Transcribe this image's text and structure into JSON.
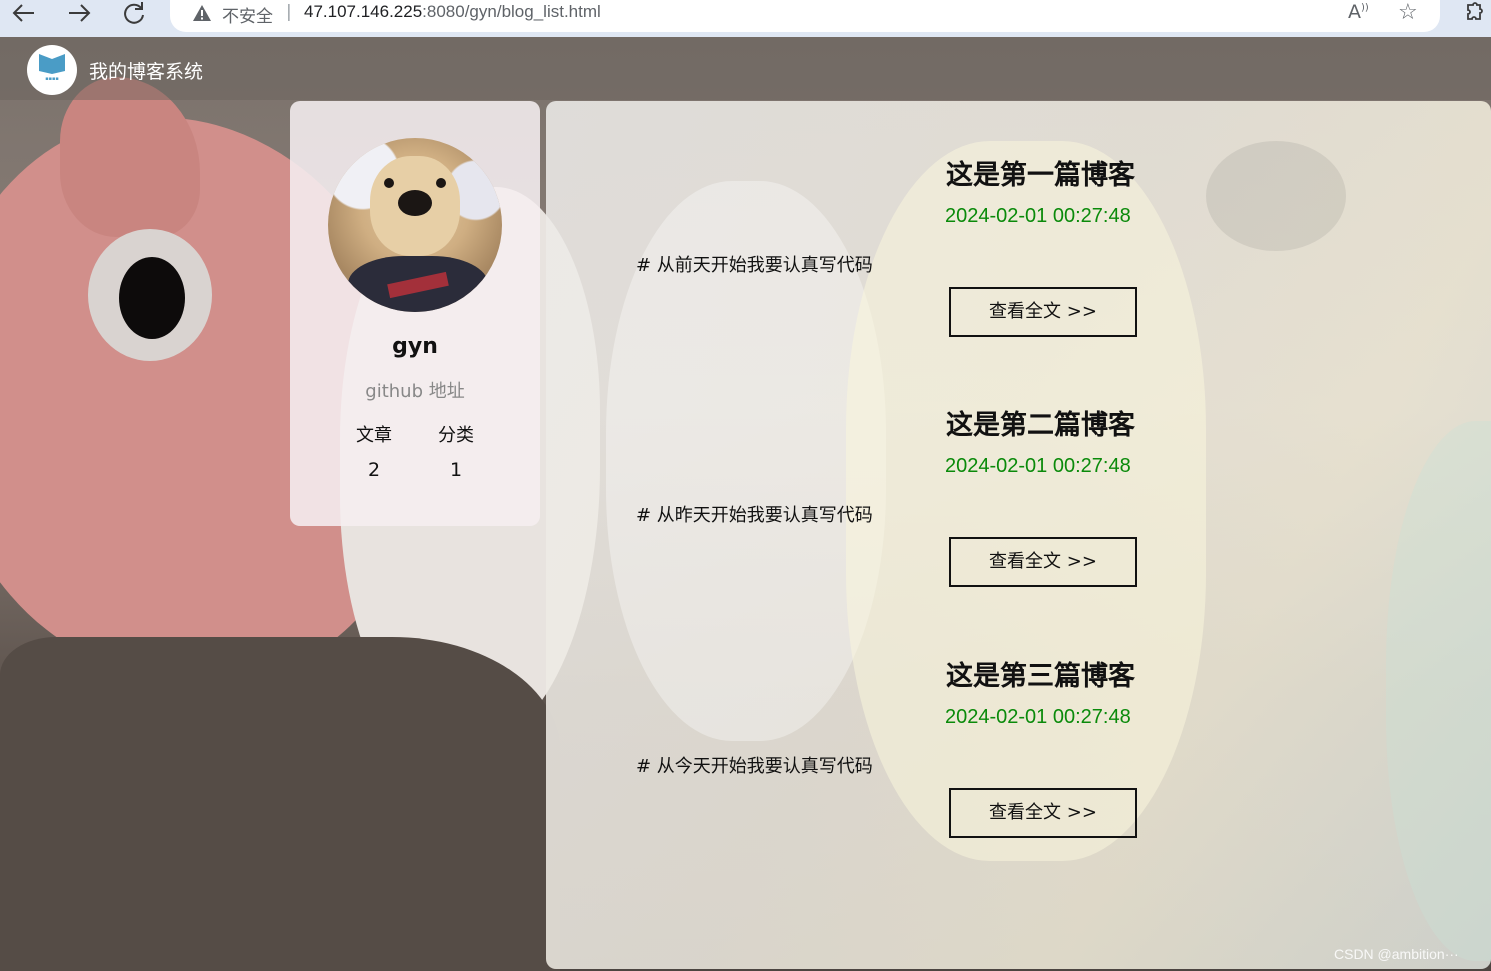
{
  "browser": {
    "security_label": "不安全",
    "separator": "|",
    "url_host": "47.107.146.225",
    "url_rest": ":8080/gyn/blog_list.html"
  },
  "header": {
    "site_title": "我的博客系统"
  },
  "profile": {
    "username": "gyn",
    "github_label": "github 地址",
    "stats": [
      {
        "label": "文章",
        "value": "2"
      },
      {
        "label": "分类",
        "value": "1"
      }
    ]
  },
  "blogs": [
    {
      "title": "这是第一篇博客",
      "date": "2024-02-01 00:27:48",
      "desc": "# 从前天开始我要认真写代码",
      "button": "查看全文 >>"
    },
    {
      "title": "这是第二篇博客",
      "date": "2024-02-01 00:27:48",
      "desc": "# 从昨天开始我要认真写代码",
      "button": "查看全文 >>"
    },
    {
      "title": "这是第三篇博客",
      "date": "2024-02-01 00:27:48",
      "desc": "# 从今天开始我要认真写代码",
      "button": "查看全文 >>"
    }
  ],
  "watermark": "CSDN @ambition···",
  "colors": {
    "date_green": "#0a8a0a",
    "chrome_bg": "#dfe7f3",
    "logo_blue": "#4a9cc6"
  },
  "icons": {
    "back": "arrow-left-icon",
    "forward": "arrow-right-icon",
    "reload": "reload-icon",
    "warning": "warning-icon",
    "read_aloud": "read-aloud-icon",
    "favorite": "star-icon",
    "extensions": "puzzle-icon"
  }
}
